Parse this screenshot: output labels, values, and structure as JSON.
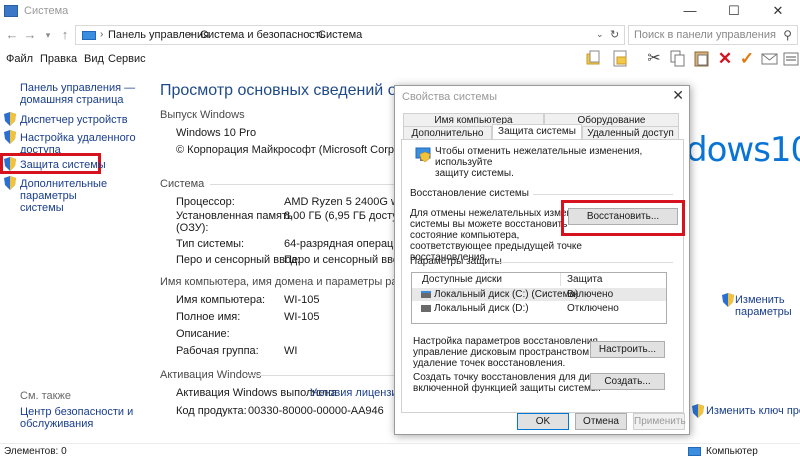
{
  "window": {
    "title": "Система"
  },
  "address": {
    "crumbs": [
      "Панель управления",
      "Система и безопасность",
      "Система"
    ],
    "search_placeholder": "Поиск в панели управления"
  },
  "menu": [
    "Файл",
    "Правка",
    "Вид",
    "Сервис"
  ],
  "left_nav": {
    "home": [
      "Панель управления —",
      "домашняя страница"
    ],
    "items": [
      {
        "label": [
          "Диспетчер устройств"
        ]
      },
      {
        "label": [
          "Настройка удаленного",
          "доступа"
        ]
      },
      {
        "label": [
          "Защита системы"
        ]
      },
      {
        "label": [
          "Дополнительные параметры",
          "системы"
        ]
      }
    ],
    "see_also": "См. также",
    "security_center": [
      "Центр безопасности и",
      "обслуживания"
    ]
  },
  "main": {
    "title": "Просмотр основных сведений о вашем компь",
    "edition": {
      "header": "Выпуск Windows",
      "name": "Windows 10 Pro",
      "copyright": "© Корпорация Майкрософт (Microsoft Corporation), 20"
    },
    "logo": "dows10",
    "system": {
      "header": "Система",
      "rows": [
        {
          "label": "Процессор:",
          "value": "AMD Ryzen 5 2400G with Rad"
        },
        {
          "label": "Установленная память",
          "label2": "(ОЗУ):",
          "value": "8,00 ГБ (6,95 ГБ доступно)"
        },
        {
          "label": "Тип системы:",
          "value": "64-разрядная операционна"
        },
        {
          "label": "Перо и сенсорный ввод:",
          "value": "Перо и сенсорный ввод н"
        }
      ]
    },
    "computer": {
      "header": "Имя компьютера, имя домена и параметры рабочей группы",
      "rows": [
        {
          "label": "Имя компьютера:",
          "value": "WI-105"
        },
        {
          "label": "Полное имя:",
          "value": "WI-105"
        },
        {
          "label": "Описание:",
          "value": ""
        },
        {
          "label": "Рабочая группа:",
          "value": "WI"
        }
      ],
      "change_link": [
        "Изменить",
        "параметры"
      ]
    },
    "activation": {
      "header": "Активация Windows",
      "status": "Активация Windows выполнена",
      "license_link": "Условия лицензионно",
      "product_label": "Код продукта:",
      "product_key": "00330-80000-00000-AA946",
      "change_key_link": "Изменить ключ продукта"
    }
  },
  "status": {
    "left": "Элементов: 0",
    "right": "Компьютер"
  },
  "dialog": {
    "title": "Свойства системы",
    "tabs_row1": [
      "Имя компьютера",
      "Оборудование"
    ],
    "tabs_row2": [
      "Дополнительно",
      "Защита системы",
      "Удаленный доступ"
    ],
    "intro": [
      "Чтобы отменить нежелательные изменения, используйте",
      "защиту системы."
    ],
    "restore_group": "Восстановление системы",
    "restore_text": [
      "Для отмены нежелательных изменений",
      "системы вы можете восстановить",
      "состояние компьютера,",
      "соответствующее предыдущей точке",
      "восстановления."
    ],
    "restore_button": "Восстановить...",
    "protection_group": "Параметры защиты",
    "columns": [
      "Доступные диски",
      "Защита"
    ],
    "drives": [
      {
        "name": "Локальный диск (C:) (Система)",
        "state": "Включено"
      },
      {
        "name": "Локальный диск (D:)",
        "state": "Отключено"
      }
    ],
    "configure_text": [
      "Настройка параметров восстановления,",
      "управление дисковым пространством и",
      "удаление точек восстановления."
    ],
    "configure_button": "Настроить...",
    "create_text": [
      "Создать точку восстановления для дисков с",
      "включенной функцией защиты системы."
    ],
    "create_button": "Создать...",
    "ok": "OK",
    "cancel": "Отмена",
    "apply": "Применить"
  }
}
